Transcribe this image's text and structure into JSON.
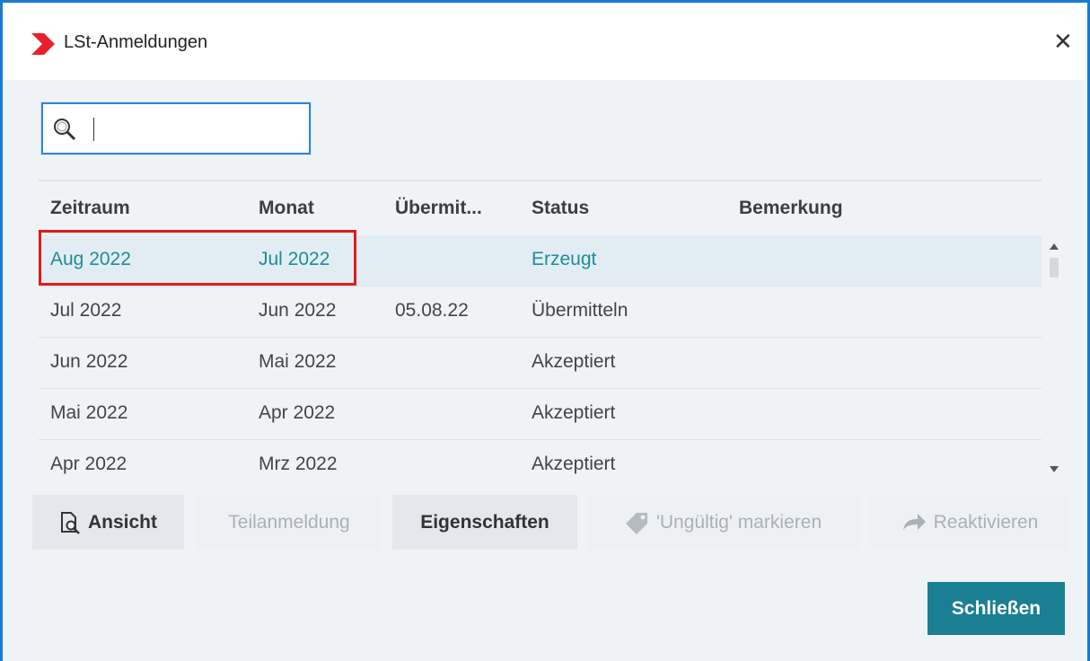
{
  "window": {
    "title": "LSt-Anmeldungen",
    "close_icon": "close-icon"
  },
  "search": {
    "value": "",
    "placeholder": ""
  },
  "table": {
    "columns": [
      "Zeitraum",
      "Monat",
      "Übermit...",
      "Status",
      "Bemerkung"
    ],
    "rows": [
      {
        "zeitraum": "Aug 2022",
        "monat": "Jul 2022",
        "uebermittelt": "",
        "status": "Erzeugt",
        "bemerkung": "",
        "selected": true
      },
      {
        "zeitraum": "Jul 2022",
        "monat": "Jun 2022",
        "uebermittelt": "05.08.22",
        "status": "Übermitteln",
        "bemerkung": ""
      },
      {
        "zeitraum": "Jun 2022",
        "monat": "Mai 2022",
        "uebermittelt": "",
        "status": "Akzeptiert",
        "bemerkung": ""
      },
      {
        "zeitraum": "Mai 2022",
        "monat": "Apr 2022",
        "uebermittelt": "",
        "status": "Akzeptiert",
        "bemerkung": ""
      },
      {
        "zeitraum": "Apr 2022",
        "monat": "Mrz 2022",
        "uebermittelt": "",
        "status": "Akzeptiert",
        "bemerkung": ""
      }
    ]
  },
  "toolbar": {
    "ansicht": "Ansicht",
    "teilanmeldung": "Teilanmeldung",
    "eigenschaften": "Eigenschaften",
    "ungueltig": "'Ungültig' markieren",
    "reaktivieren": "Reaktivieren"
  },
  "footer": {
    "close_label": "Schließen"
  },
  "colors": {
    "accent": "#1a7f92",
    "selection": "#e2edf3",
    "highlight": "#e31a1a",
    "window_border": "#1a7ad0",
    "logo": "#e8202a"
  }
}
